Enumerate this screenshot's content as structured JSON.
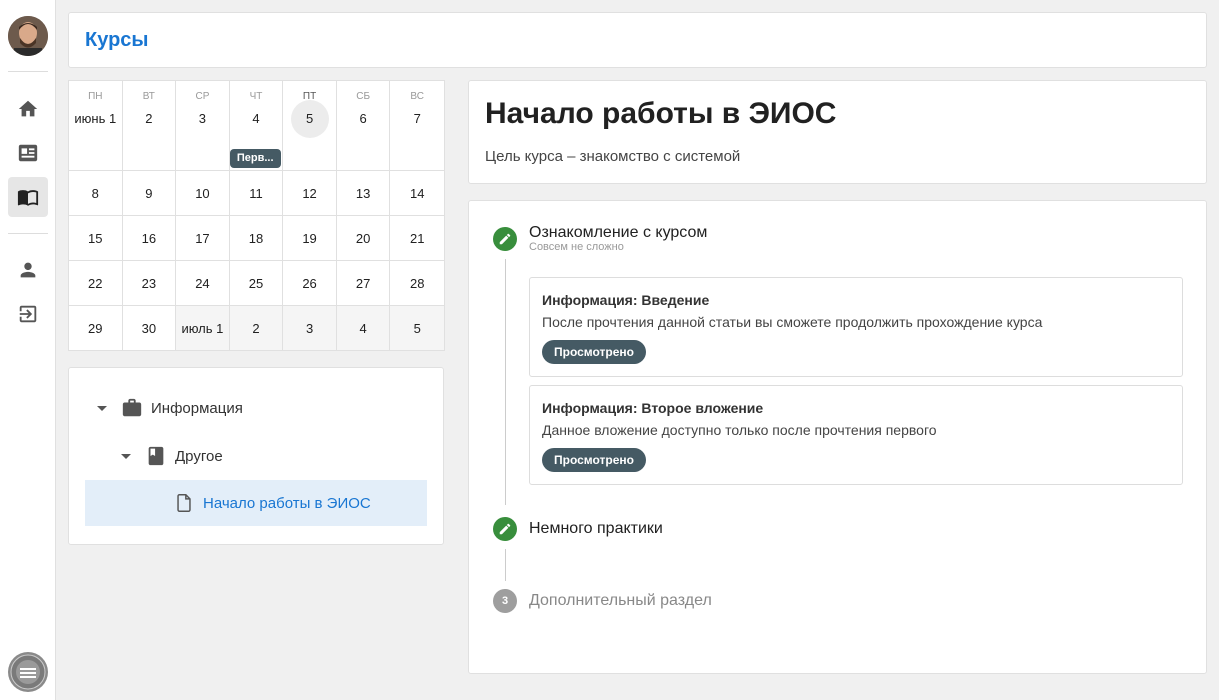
{
  "header": {
    "title": "Курсы"
  },
  "rail": {
    "items": [
      "home-icon",
      "news-icon",
      "book-icon",
      "person-icon",
      "logout-icon"
    ],
    "active": "book-icon"
  },
  "calendar": {
    "weekdays": [
      "ПН",
      "ВТ",
      "СР",
      "ЧТ",
      "ПТ",
      "СБ",
      "ВС"
    ],
    "today_weekday": "ПТ",
    "rows": [
      [
        "июнь 1",
        "2",
        "3",
        "4",
        "5",
        "6",
        "7"
      ],
      [
        "8",
        "9",
        "10",
        "11",
        "12",
        "13",
        "14"
      ],
      [
        "15",
        "16",
        "17",
        "18",
        "19",
        "20",
        "21"
      ],
      [
        "22",
        "23",
        "24",
        "25",
        "26",
        "27",
        "28"
      ],
      [
        "29",
        "30",
        "июль 1",
        "2",
        "3",
        "4",
        "5"
      ]
    ],
    "today": "5",
    "event": {
      "day": "4",
      "label": "Перв..."
    }
  },
  "tree": {
    "items": [
      {
        "label": "Информация",
        "icon": "briefcase-icon"
      },
      {
        "label": "Другое",
        "icon": "book-closed-icon"
      },
      {
        "label": "Начало работы в ЭИОС",
        "icon": "file-icon",
        "selected": true
      }
    ]
  },
  "course": {
    "title": "Начало работы в ЭИОС",
    "description": "Цель курса – знакомство с системой"
  },
  "steps": [
    {
      "title": "Ознакомление с курсом",
      "subtitle": "Совсем не сложно",
      "items": [
        {
          "title": "Информация: Введение",
          "description": "После прочтения данной статьи вы сможете продолжить прохождение курса",
          "status": "Просмотрено"
        },
        {
          "title": "Информация: Второе вложение",
          "description": "Данное вложение доступно только после прочтения первого",
          "status": "Просмотрено"
        }
      ]
    },
    {
      "title": "Немного практики"
    },
    {
      "title": "Дополнительный раздел",
      "number": "3"
    }
  ],
  "colors": {
    "accent": "#1976d2",
    "step_done": "#388e3c",
    "badge": "#455a64"
  }
}
